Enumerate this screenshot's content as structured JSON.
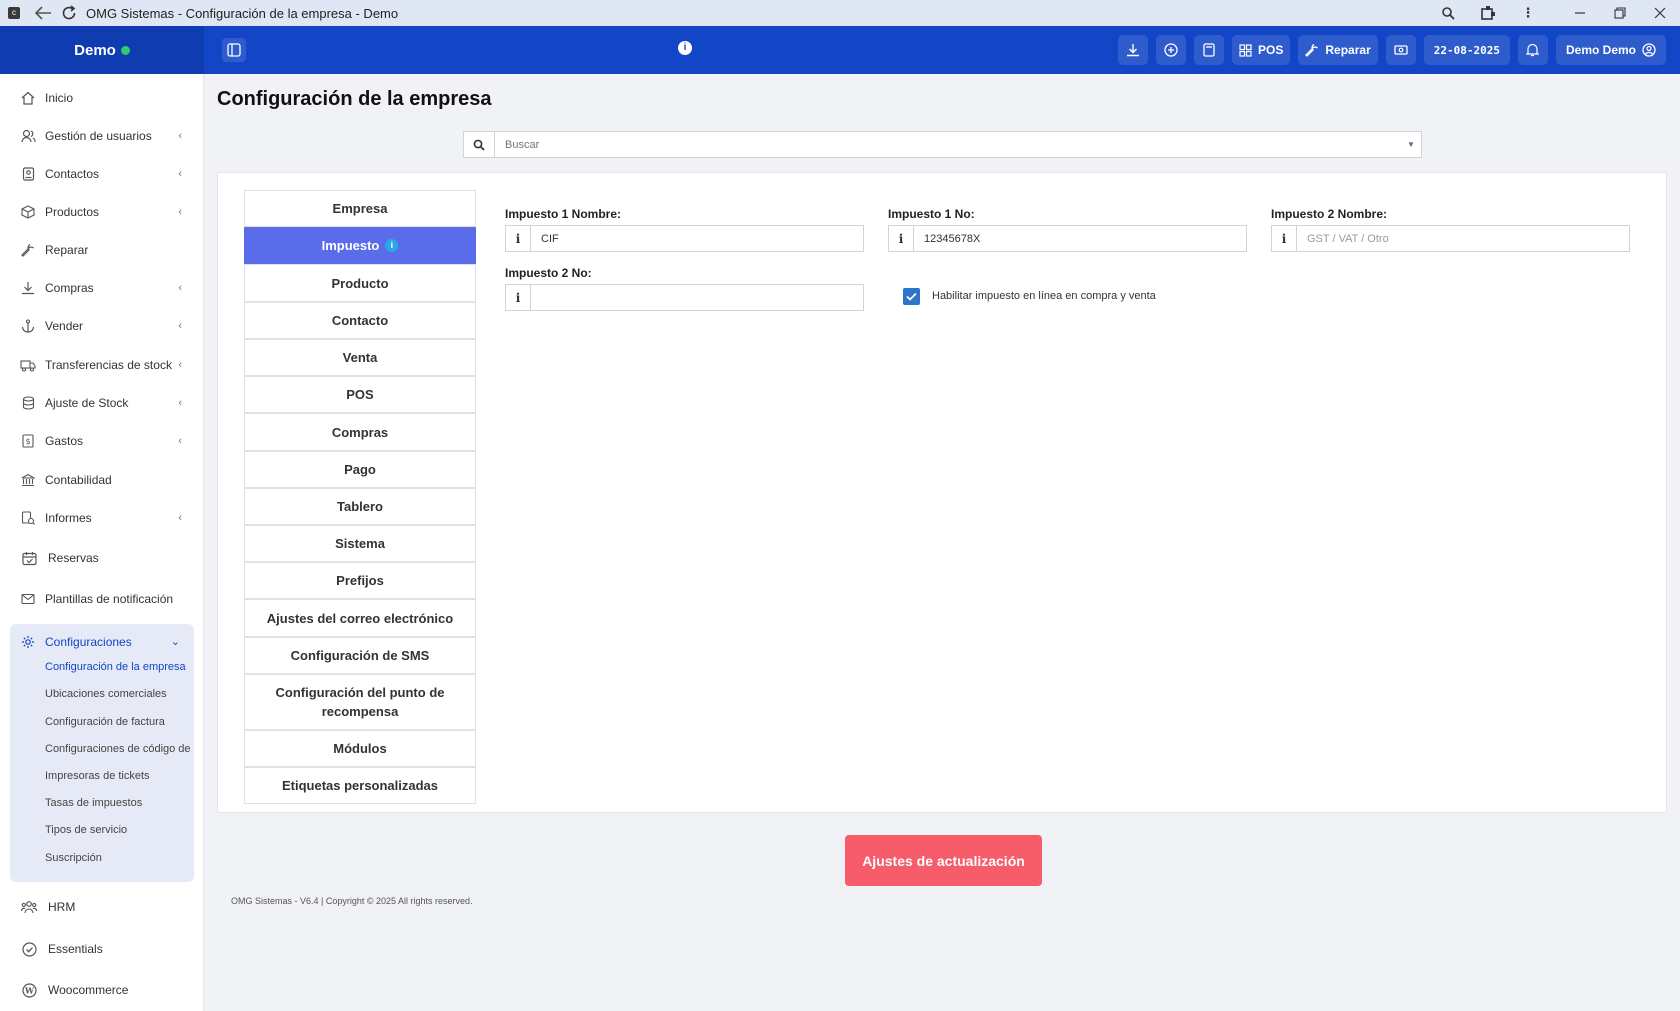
{
  "window": {
    "title": "OMG Sistemas - Configuración de la empresa - Demo"
  },
  "header": {
    "brand": "Demo",
    "pos_label": "POS",
    "repair_label": "Reparar",
    "date": "22-08-2025",
    "user": "Demo Demo"
  },
  "sidebar": {
    "items": [
      {
        "label": "Inicio",
        "icon": "home-icon",
        "chevron": false
      },
      {
        "label": "Gestión de usuarios",
        "icon": "users-icon",
        "chevron": true
      },
      {
        "label": "Contactos",
        "icon": "address-book-icon",
        "chevron": true
      },
      {
        "label": "Productos",
        "icon": "box-icon",
        "chevron": true
      },
      {
        "label": "Reparar",
        "icon": "wrench-icon",
        "chevron": false
      },
      {
        "label": "Compras",
        "icon": "download-icon",
        "chevron": true
      },
      {
        "label": "Vender",
        "icon": "anchor-icon",
        "chevron": true
      },
      {
        "label": "Transferencias de stock",
        "icon": "truck-icon",
        "chevron": true
      },
      {
        "label": "Ajuste de Stock",
        "icon": "database-icon",
        "chevron": true
      },
      {
        "label": "Gastos",
        "icon": "receipt-icon",
        "chevron": true
      },
      {
        "label": "Contabilidad",
        "icon": "bank-icon",
        "chevron": false
      },
      {
        "label": "Informes",
        "icon": "report-icon",
        "chevron": true
      },
      {
        "label": "Reservas",
        "icon": "calendar-check-icon",
        "chevron": false
      },
      {
        "label": "Plantillas de notificación",
        "icon": "mail-icon",
        "chevron": false
      }
    ],
    "config": {
      "label": "Configuraciones",
      "sub": [
        "Configuración de la empresa",
        "Ubicaciones comerciales",
        "Configuración de factura",
        "Configuraciones de código de barras",
        "Impresoras de tickets",
        "Tasas de impuestos",
        "Tipos de servicio",
        "Suscripción"
      ]
    },
    "bottom": [
      {
        "label": "HRM",
        "icon": "people-icon"
      },
      {
        "label": "Essentials",
        "icon": "check-circle-icon"
      },
      {
        "label": "Woocommerce",
        "icon": "wordpress-icon"
      }
    ]
  },
  "main": {
    "title": "Configuración de la empresa",
    "search_placeholder": "Buscar",
    "tabs": [
      "Empresa",
      "Impuesto",
      "Producto",
      "Contacto",
      "Venta",
      "POS",
      "Compras",
      "Pago",
      "Tablero",
      "Sistema",
      "Prefijos",
      "Ajustes del correo electrónico",
      "Configuración de SMS",
      "Configuración del punto de recompensa",
      "Módulos",
      "Etiquetas personalizadas"
    ],
    "active_tab": 1,
    "fields": {
      "tax1_name_label": "Impuesto 1 Nombre:",
      "tax1_name_value": "CIF",
      "tax1_no_label": "Impuesto 1 No:",
      "tax1_no_value": "12345678X",
      "tax2_name_label": "Impuesto 2 Nombre:",
      "tax2_name_placeholder": "GST / VAT / Otro",
      "tax2_no_label": "Impuesto 2 No:",
      "tax2_no_value": ""
    },
    "inline_tax_label": "Habilitar impuesto en línea en compra y venta",
    "update_button": "Ajustes de actualización",
    "footer": "OMG Sistemas - V6.4 | Copyright © 2025 All rights reserved."
  }
}
